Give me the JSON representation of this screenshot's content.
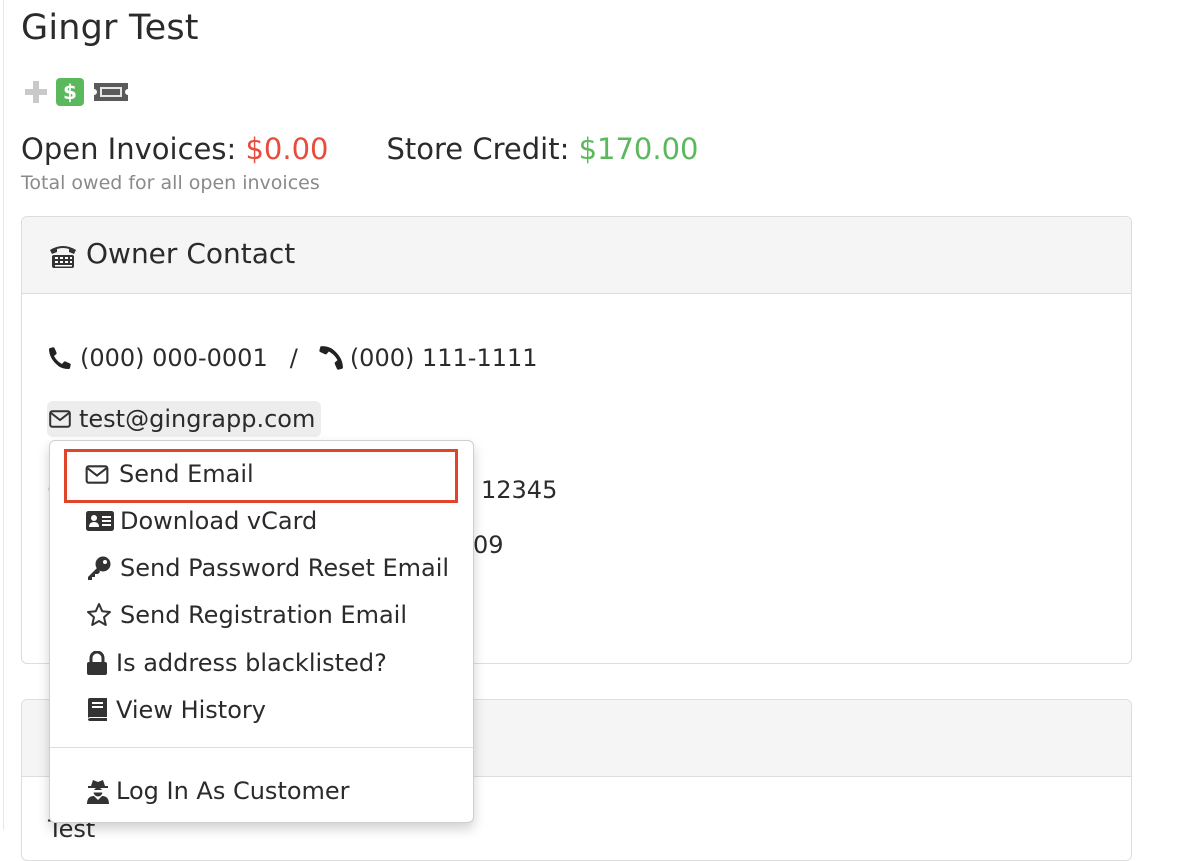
{
  "page": {
    "title": "Gingr Test"
  },
  "quick_actions": [
    {
      "icon": "plus-icon"
    },
    {
      "icon": "dollar-icon",
      "glyph": "$"
    },
    {
      "icon": "ticket-icon"
    }
  ],
  "balances": {
    "open_invoices_label": "Open Invoices:",
    "open_invoices_value": "$0.00",
    "store_credit_label": "Store Credit:",
    "store_credit_value": "$170.00",
    "note": "Total owed for all open invoices"
  },
  "contact_panel": {
    "title": "Owner Contact",
    "phone_primary": "(000) 000-0001",
    "separator": "/",
    "phone_secondary": "(000) 111-1111",
    "email": "test@gingrapp.com",
    "partial_zip": "12345",
    "partial_line": "09"
  },
  "second_panel": {
    "partial_text": "Test"
  },
  "email_menu": {
    "items": [
      {
        "label": "Send Email",
        "icon": "envelope-icon"
      },
      {
        "label": "Download vCard",
        "icon": "id-card-icon"
      },
      {
        "label": "Send Password Reset Email",
        "icon": "key-icon"
      },
      {
        "label": "Send Registration Email",
        "icon": "star-icon"
      },
      {
        "label": "Is address blacklisted?",
        "icon": "lock-icon"
      },
      {
        "label": "View History",
        "icon": "book-icon"
      },
      {
        "label": "Log In As Customer",
        "icon": "user-secret-icon"
      }
    ]
  },
  "colors": {
    "negative_amount": "#e74c3c",
    "positive_amount": "#5cb85c",
    "highlight": "#e0452c"
  }
}
